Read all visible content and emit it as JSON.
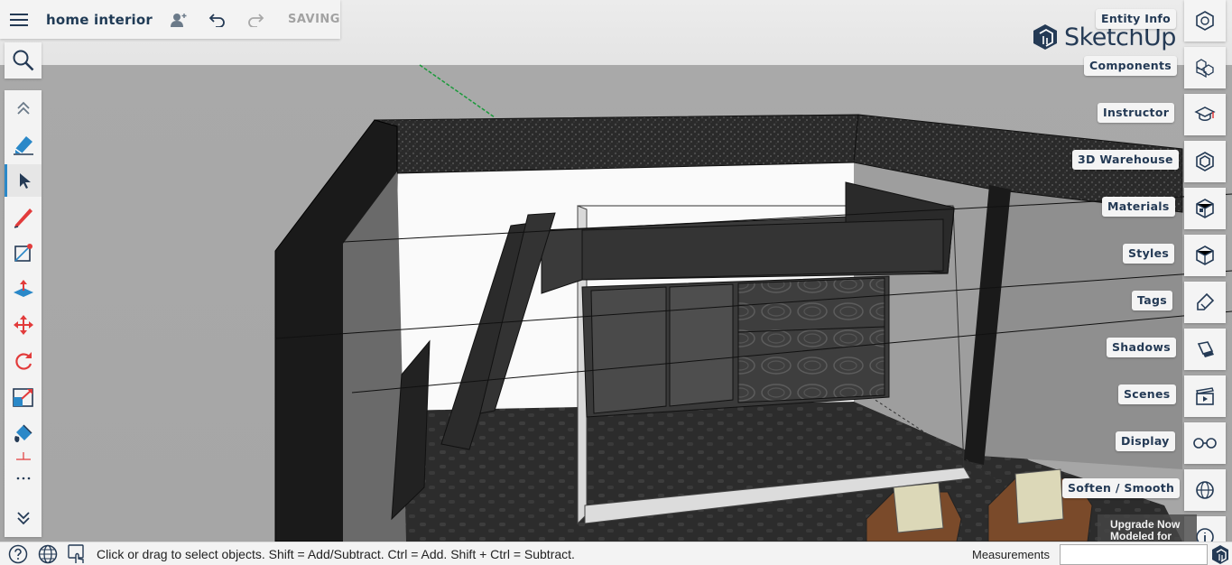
{
  "header": {
    "menu_icon": "hamburger-menu-icon",
    "title": "home interior",
    "share_icon": "add-collaborator-icon",
    "undo_icon": "undo-icon",
    "redo_icon": "redo-icon",
    "saving_label": "SAVING"
  },
  "search": {
    "icon": "search-icon"
  },
  "toolbar": {
    "tools": [
      "collapse-up-icon",
      "eraser-icon",
      "select-arrow-icon",
      "pencil-line-icon",
      "rectangle-icon",
      "push-pull-icon",
      "move-icon",
      "rotate-icon",
      "scale-icon",
      "paint-bucket-icon",
      "more-tools-icon",
      "expand-down-icon"
    ],
    "active_tool": "select-arrow-icon"
  },
  "brand": {
    "logo_text": "SketchUp",
    "color": "#243a55"
  },
  "right_panel": {
    "items": [
      {
        "label": "Entity Info",
        "icon": "entity-info-icon"
      },
      {
        "label": "Components",
        "icon": "components-icon"
      },
      {
        "label": "Instructor",
        "icon": "instructor-icon"
      },
      {
        "label": "3D Warehouse",
        "icon": "3d-warehouse-icon"
      },
      {
        "label": "Materials",
        "icon": "materials-icon"
      },
      {
        "label": "Styles",
        "icon": "styles-icon"
      },
      {
        "label": "Tags",
        "icon": "tags-icon"
      },
      {
        "label": "Shadows",
        "icon": "shadows-icon"
      },
      {
        "label": "Scenes",
        "icon": "scenes-icon"
      },
      {
        "label": "Display",
        "icon": "display-icon"
      },
      {
        "label": "Soften / Smooth",
        "icon": "soften-smooth-icon"
      },
      {
        "label": "",
        "icon": "info-icon"
      }
    ]
  },
  "upgrade": {
    "line1": "Upgrade Now",
    "line2": "Modeled for"
  },
  "status_bar": {
    "help_icon": "help-icon",
    "globe_icon": "globe-icon",
    "gesture_icon": "touch-gesture-icon",
    "message": "Click or drag to select objects. Shift = Add/Subtract. Ctrl = Add. Shift + Ctrl = Subtract.",
    "measurements_label": "Measurements",
    "measurements_value": ""
  },
  "colors": {
    "accent": "#2a88c8",
    "navy": "#243a55",
    "panel": "#f3f3f3"
  }
}
